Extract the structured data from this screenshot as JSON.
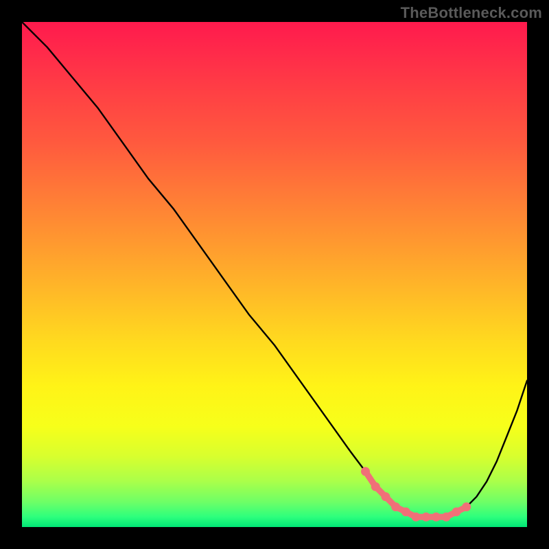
{
  "watermark": "TheBottleneck.com",
  "colors": {
    "frame": "#000000",
    "curve": "#000000",
    "marker": "#f07078",
    "gradient_stops": [
      "#ff1a4d",
      "#ff2a4a",
      "#ff4044",
      "#ff5a3e",
      "#ff7a37",
      "#ff9a2f",
      "#ffbb27",
      "#ffd91f",
      "#fff317",
      "#f7ff1a",
      "#d8ff2e",
      "#aaff4a",
      "#6fff66",
      "#2dff7d",
      "#00e676"
    ]
  },
  "chart_data": {
    "type": "line",
    "title": "",
    "xlabel": "",
    "ylabel": "",
    "xlim": [
      0,
      100
    ],
    "ylim": [
      0,
      100
    ],
    "grid": false,
    "legend": false,
    "series": [
      {
        "name": "bottleneck-curve",
        "x": [
          0,
          5,
          10,
          15,
          20,
          25,
          30,
          35,
          40,
          45,
          50,
          55,
          60,
          65,
          68,
          70,
          72,
          74,
          76,
          78,
          80,
          82,
          84,
          86,
          88,
          90,
          92,
          94,
          96,
          98,
          100
        ],
        "values": [
          100,
          95,
          89,
          83,
          76,
          69,
          63,
          56,
          49,
          42,
          36,
          29,
          22,
          15,
          11,
          8,
          6,
          4,
          3,
          2,
          2,
          2,
          2,
          3,
          4,
          6,
          9,
          13,
          18,
          23,
          29
        ]
      }
    ],
    "markers": {
      "name": "optimal-range",
      "x": [
        68,
        70,
        72,
        74,
        76,
        78,
        80,
        82,
        84,
        86,
        88
      ],
      "values": [
        11,
        8,
        6,
        4,
        3,
        2,
        2,
        2,
        2,
        3,
        4
      ]
    }
  }
}
